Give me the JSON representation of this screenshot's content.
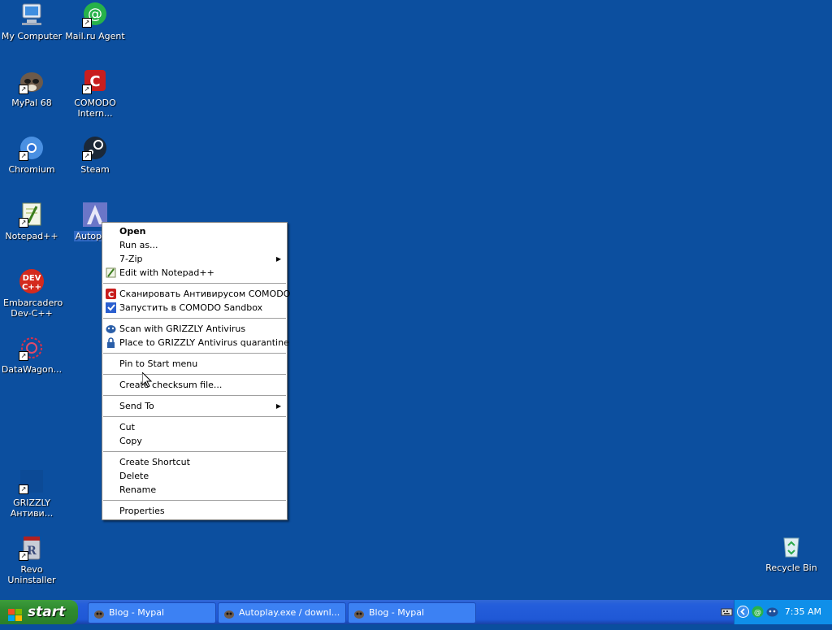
{
  "desktop": {
    "icons": [
      {
        "label": "My Computer",
        "icon": "my-computer-icon"
      },
      {
        "label": "Mail.ru Agent",
        "icon": "mailru-agent-icon"
      },
      {
        "label": "MyPal 68",
        "icon": "mypal-icon"
      },
      {
        "label": "COMODO Intern...",
        "icon": "comodo-icon"
      },
      {
        "label": "Chromium",
        "icon": "chromium-icon"
      },
      {
        "label": "Steam",
        "icon": "steam-icon"
      },
      {
        "label": "Notepad++",
        "icon": "notepadpp-icon"
      },
      {
        "label": "Autoplay",
        "icon": "autoplay-icon"
      },
      {
        "label": "Embarcadero Dev-C++",
        "icon": "devcpp-icon"
      },
      {
        "label": "DataWagon...",
        "icon": "datawagon-icon"
      },
      {
        "label": "GRIZZLY Антиви...",
        "icon": "grizzly-icon"
      },
      {
        "label": "Revo Uninstaller",
        "icon": "revo-icon"
      },
      {
        "label": "Recycle Bin",
        "icon": "recycle-bin-icon"
      }
    ]
  },
  "context_menu": {
    "items": [
      {
        "label": "Open"
      },
      {
        "label": "Run as..."
      },
      {
        "label": "7-Zip"
      },
      {
        "label": "Edit with Notepad++"
      },
      {
        "label": "Сканировать Антивирусом COMODO"
      },
      {
        "label": "Запустить в COMODO Sandbox"
      },
      {
        "label": "Scan with GRIZZLY Antivirus"
      },
      {
        "label": "Place to GRIZZLY Antivirus quarantine"
      },
      {
        "label": "Pin to Start menu"
      },
      {
        "label": "Create checksum file..."
      },
      {
        "label": "Send To"
      },
      {
        "label": "Cut"
      },
      {
        "label": "Copy"
      },
      {
        "label": "Create Shortcut"
      },
      {
        "label": "Delete"
      },
      {
        "label": "Rename"
      },
      {
        "label": "Properties"
      }
    ],
    "submenu_arrow": "▶"
  },
  "taskbar": {
    "start_label": "start",
    "tasks": [
      {
        "label": "Blog - Mypal"
      },
      {
        "label": "Autoplay.exe / downl..."
      },
      {
        "label": "Blog - Mypal"
      }
    ],
    "clock": "7:35 AM"
  },
  "colors": {
    "desktop": "#0c4f9f",
    "taskbar": "#245edb",
    "start_button": "#2f8b2f",
    "tray": "#0f8fe9",
    "selection": "#316ac5"
  }
}
